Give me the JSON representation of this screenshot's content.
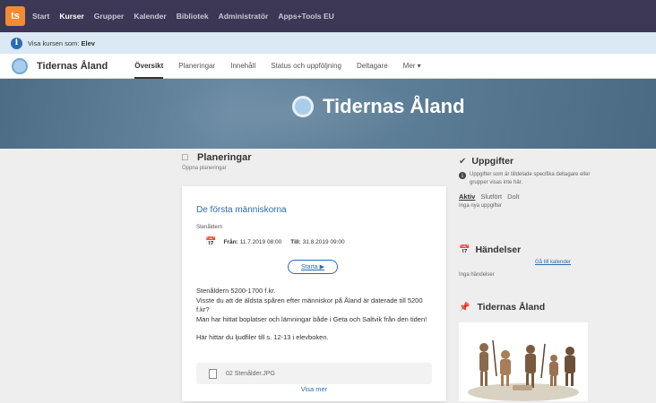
{
  "topnav": {
    "logo": "ts",
    "items": [
      {
        "label": "Start",
        "active": false
      },
      {
        "label": "Kurser",
        "active": true
      },
      {
        "label": "Grupper",
        "active": false
      },
      {
        "label": "Kalender",
        "active": false
      },
      {
        "label": "Bibliotek",
        "active": false
      },
      {
        "label": "Administratör",
        "active": false
      },
      {
        "label": "Apps+Tools EU",
        "active": false
      }
    ]
  },
  "infobar": {
    "prefix": "Visa kursen som: ",
    "role": "Elev"
  },
  "coursebar": {
    "title": "Tidernas Åland",
    "tabs": [
      "Översikt",
      "Planeringar",
      "Innehåll",
      "Status och uppföljning",
      "Deltagare",
      "Mer ▾"
    ]
  },
  "banner": {
    "title": "Tidernas Åland"
  },
  "planeringar": {
    "title": "Planeringar",
    "sub": "Öppna planeringar",
    "card": {
      "title": "De första människorna",
      "category": "Stenåldern",
      "from_label": "Från:",
      "from_value": "11.7.2019 08:00",
      "to_label": "Till:",
      "to_value": "31.8.2019 09:00",
      "start_button": "Starta ▶",
      "body": [
        "Stenåldern 5200-1700 f.kr.",
        "Visste du att de äldsta spåren efter människor på Åland är daterade till 5200 f.kr?",
        "Man har hittat boplatser och lämningar både i Geta och Saltvik från den tiden!"
      ],
      "extra": "Här hittar du ljudfiler till s. 12-13 i elevboken.",
      "file": "02 Stenålder.JPG",
      "more": "Visa mer"
    }
  },
  "uppgifter": {
    "title": "Uppgifter",
    "note": "Uppgifter som är tilldelade specifika deltagare eller grupper visas inte här.",
    "tabs": [
      {
        "label": "Aktiv",
        "active": true
      },
      {
        "label": "Slutfört",
        "active": false
      },
      {
        "label": "Dolt",
        "active": false
      }
    ],
    "empty": "Inga nya uppgifter"
  },
  "handelser": {
    "title": "Händelser",
    "link": "Gå till kalender",
    "empty": "Inga händelser"
  },
  "course_section": {
    "title": "Tidernas Åland"
  },
  "colors": {
    "nav": "#3b3754",
    "accent": "#2a6db0",
    "logo": "#f28b32",
    "infobar": "#dbe9f5"
  }
}
